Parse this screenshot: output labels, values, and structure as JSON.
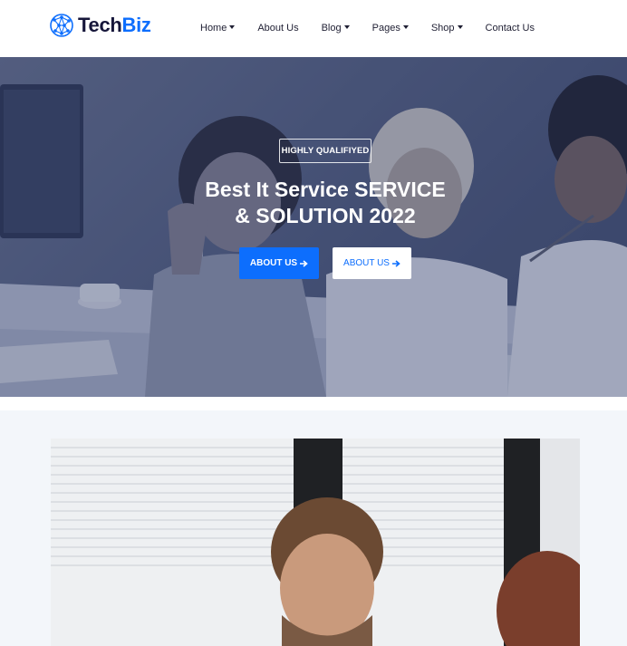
{
  "brand": {
    "name_part1": "Tech",
    "name_part2": "Biz",
    "accent_color": "#0d6efd",
    "dark_color": "#16163a",
    "icon": "globe-network-icon"
  },
  "nav": {
    "items": [
      {
        "label": "Home",
        "has_dropdown": true
      },
      {
        "label": "About Us",
        "has_dropdown": false
      },
      {
        "label": "Blog",
        "has_dropdown": true
      },
      {
        "label": "Pages",
        "has_dropdown": true
      },
      {
        "label": "Shop",
        "has_dropdown": true
      },
      {
        "label": "Contact Us",
        "has_dropdown": false
      }
    ]
  },
  "hero": {
    "badge": "HIGHLY QUALIFIYED",
    "title_line1": "Best It Service SERVICE",
    "title_line2": "& SOLUTION 2022",
    "primary_button": {
      "label": "ABOUT US",
      "icon": "arrow-right-icon"
    },
    "secondary_button": {
      "label": "ABOUT US",
      "icon": "arrow-right-icon"
    },
    "overlay_color": "#283460"
  },
  "section": {
    "background": "#f3f6fa"
  }
}
